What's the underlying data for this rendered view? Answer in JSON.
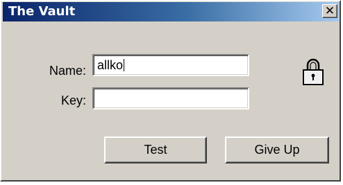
{
  "window": {
    "title": "The Vault",
    "close_label": "✕"
  },
  "form": {
    "name_label": "Name:",
    "name_value": "allko",
    "key_label": "Key:",
    "key_value": ""
  },
  "buttons": {
    "test_label": "Test",
    "giveup_label": "Give Up"
  },
  "icons": {
    "lock": "lock-icon",
    "close": "close-icon"
  },
  "colors": {
    "title_gradient_start": "#0a246a",
    "title_gradient_end": "#a6caf0",
    "face": "#d4d0c8"
  }
}
